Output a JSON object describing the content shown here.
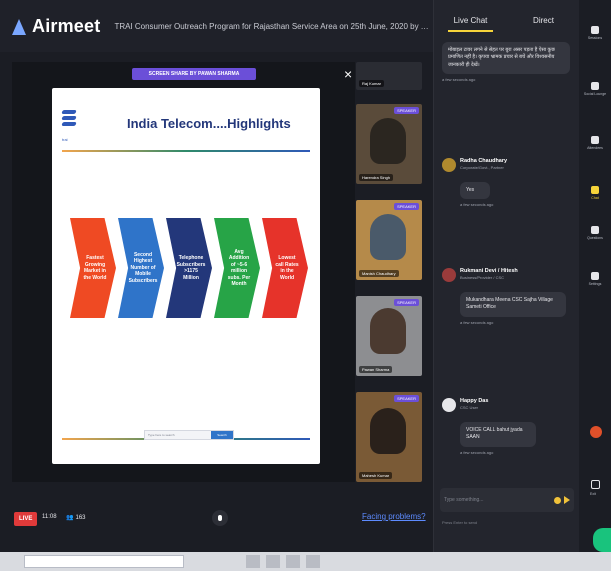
{
  "header": {
    "app_name": "Airmeet",
    "event_title": "TRAI Consumer Outreach Program for Rajasthan Service Area on 25th June, 2020 by TRAI, RO, J..."
  },
  "stage": {
    "speaker_badge": "SCREEN SHARE BY PAWAN SHARMA",
    "close_glyph": "×",
    "slide": {
      "logo_text": "trai",
      "title": "India Telecom....Highlights",
      "highlights": [
        "Fastest Growing Market in the World",
        "Second Highest Number of Mobile Subscribers",
        "Telephone Subscribers >1175 Million",
        "Avg Addition of ~5-6 million subs. Per Month",
        "Lowest call Rates in the World"
      ],
      "search_placeholder": "Type here to search",
      "search_button": "Search"
    }
  },
  "tiles": [
    {
      "name": "Raj Kumar",
      "badge": ""
    },
    {
      "name": "Harendra Singh",
      "badge": "SPEAKER"
    },
    {
      "name": "Manish Chaudhary",
      "badge": "SPEAKER"
    },
    {
      "name": "Pawan Sharma",
      "badge": "SPEAKER"
    },
    {
      "name": "Mahesh Kumar",
      "badge": "SPEAKER"
    }
  ],
  "bottombar": {
    "live": "LIVE",
    "timer": "11:08",
    "viewers": "163",
    "facing_problems": "Facing problems?"
  },
  "chat": {
    "tabs": [
      "Live Chat",
      "Direct"
    ],
    "messages": [
      {
        "name": "",
        "role": "",
        "text": "मोबाइल टावर लगने से सेहत पर बुरा असर पड़ता है ऐसा कुछ प्रमाणित नहीं है। कृपया भ्रामक प्रचार से बचें और विश्वसनीय जानकारी ही देखें।",
        "time": "a few seconds ago"
      },
      {
        "name": "Radha Chaudhary",
        "role": "Corporate/Govt., Partner",
        "text": "Yes",
        "time": "a few seconds ago"
      },
      {
        "name": "Rukmani Devi / Hitesh",
        "role": "Business/Provider / CSC",
        "text": "Mukandhara Meena CSC Sajha Village Sameti Office",
        "time": "a few seconds ago"
      },
      {
        "name": "Happy Das",
        "role": "CSC User",
        "text": "VOICE CALL bahut jyada SAAN",
        "time": "a few seconds ago"
      }
    ],
    "compose_placeholder": "Type something...",
    "footer": "Press Enter to send"
  },
  "rail": {
    "items": [
      "Sessions",
      "Social Lounge",
      "Attendees",
      "Chat",
      "Questions",
      "Settings"
    ],
    "exit": "Exit"
  },
  "colors": {
    "accent": "#f6d43a",
    "live": "#e03a3a",
    "badge": "#6b4fd8",
    "link": "#5d8bff"
  }
}
